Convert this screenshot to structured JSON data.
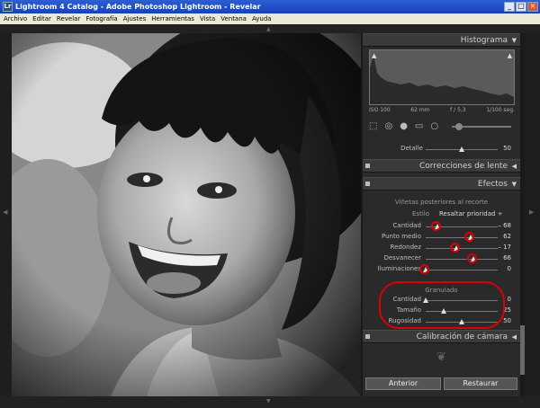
{
  "window": {
    "title": "Lightroom 4 Catalog - Adobe Photoshop Lightroom - Revelar",
    "icon": "Lr"
  },
  "menu": [
    "Archivo",
    "Editar",
    "Revelar",
    "Fotografía",
    "Ajustes",
    "Herramientas",
    "Vista",
    "Ventana",
    "Ayuda"
  ],
  "panel": {
    "histogram": {
      "title": "Histograma",
      "iso": "ISO 100",
      "focal": "62 mm",
      "aperture": "f / 5,3",
      "shutter": "1/100 seg."
    },
    "detail": {
      "label": "Detalle",
      "value": "50",
      "fraction": 0.5
    },
    "lens": {
      "title": "Correcciones de lente"
    },
    "effects": {
      "title": "Efectos",
      "vignette_title": "Viñetas posteriores al recorte",
      "estilo_label": "Estilo",
      "estilo_value": "Resaltar prioridad ÷",
      "sliders": [
        {
          "label": "Cantidad",
          "value": "– 68",
          "fraction": 0.16
        },
        {
          "label": "Punto medio",
          "value": "62",
          "fraction": 0.62
        },
        {
          "label": "Redondez",
          "value": "– 17",
          "fraction": 0.42
        },
        {
          "label": "Desvanecer",
          "value": "66",
          "fraction": 0.66
        },
        {
          "label": "Iluminaciones",
          "value": "0",
          "fraction": 0.0
        }
      ],
      "grain_title": "Granulado",
      "grain": [
        {
          "label": "Cantidad",
          "value": "0",
          "fraction": 0.0
        },
        {
          "label": "Tamaño",
          "value": "25",
          "fraction": 0.25
        },
        {
          "label": "Rugosidad",
          "value": "50",
          "fraction": 0.5
        }
      ]
    },
    "camera": {
      "title": "Calibración de cámara"
    },
    "buttons": {
      "previous": "Anterior",
      "reset": "Restaurar"
    }
  },
  "icons": {
    "panel_expand": "triangle-down-icon",
    "panel_collapsed": "triangle-left-icon",
    "crop": "crop-icon",
    "spot": "spot-removal-icon",
    "redeye": "red-eye-icon",
    "gradient": "graduated-filter-icon",
    "brush": "adjustment-brush-icon"
  },
  "colors": {
    "annotation_red": "#dd0000",
    "titlebar": "#1f4fc7"
  }
}
